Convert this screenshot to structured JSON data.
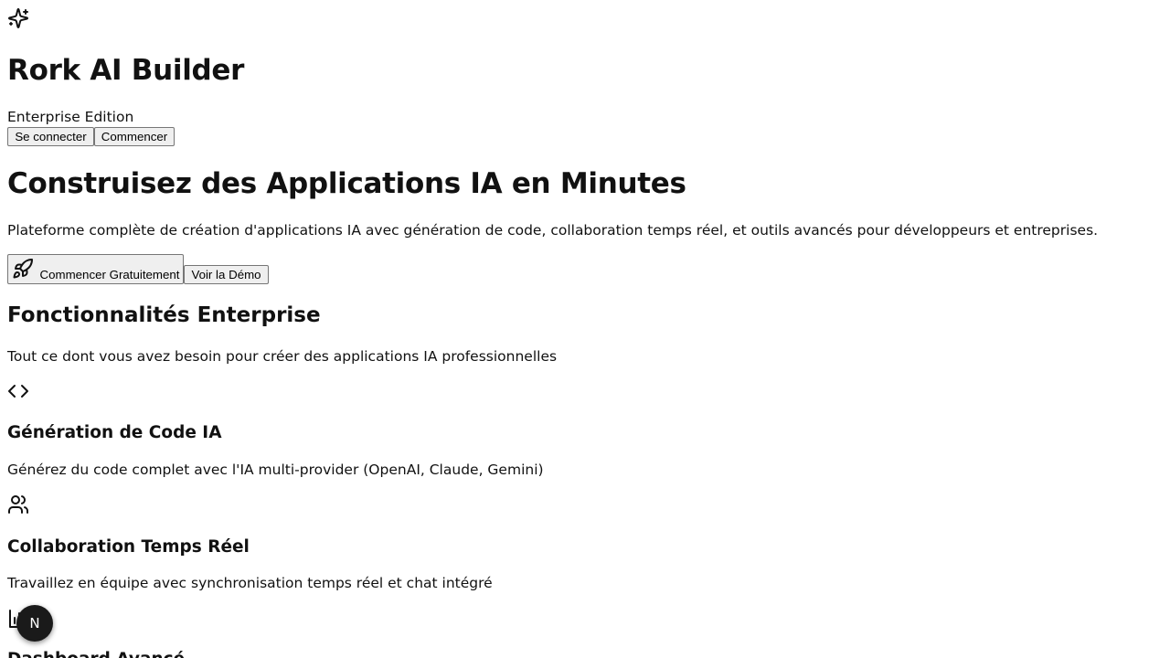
{
  "header": {
    "logo_icon": "sparkles-icon",
    "brand_title": "Rork AI Builder",
    "edition": "Enterprise Edition",
    "login_label": "Se connecter",
    "start_label": "Commencer"
  },
  "hero": {
    "title": "Construisez des Applications IA en Minutes",
    "subtitle": "Plateforme complète de création d'applications IA avec génération de code, collaboration temps réel, et outils avancés pour développeurs et entreprises.",
    "cta_icon": "rocket-icon",
    "cta_label": "Commencer Gratuitement",
    "demo_label": "Voir la Démo"
  },
  "features": {
    "title": "Fonctionnalités Enterprise",
    "subtitle": "Tout ce dont vous avez besoin pour créer des applications IA professionnelles",
    "items": [
      {
        "icon": "code-icon",
        "title": "Génération de Code IA",
        "description": "Générez du code complet avec l'IA multi-provider (OpenAI, Claude, Gemini)"
      },
      {
        "icon": "users-icon",
        "title": "Collaboration Temps Réel",
        "description": "Travaillez en équipe avec synchronisation temps réel et chat intégré"
      },
      {
        "icon": "bar-chart-icon",
        "title": "Dashboard Avancé"
      }
    ]
  },
  "dev_badge": {
    "icon": "nextjs-icon",
    "letter": "N",
    "background": "#1a1a1a"
  }
}
